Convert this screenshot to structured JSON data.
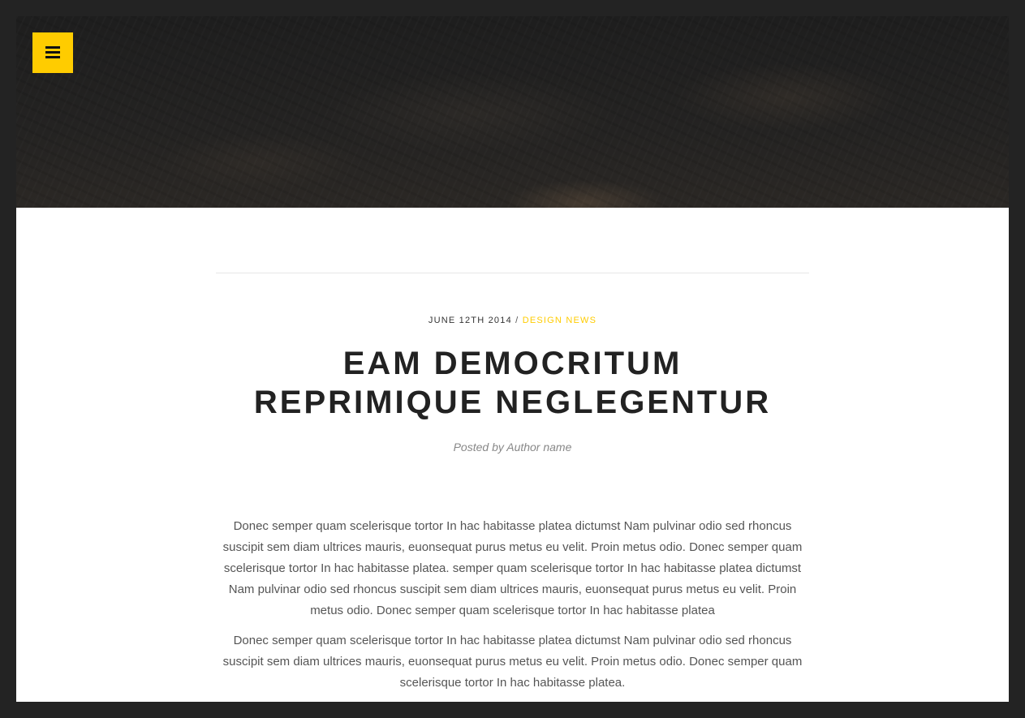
{
  "header": {
    "menu_icon": "hamburger-menu-icon",
    "accent_color": "#ffcc00"
  },
  "post": {
    "date": "JUNE 12TH 2014",
    "separator": "/",
    "category": "DESIGN NEWS",
    "title_line1": "EAM DEMOCRITUM",
    "title_line2": "REPRIMIQUE NEGLEGENTUR",
    "byline": "Posted by Author name",
    "paragraphs": [
      "Donec semper quam scelerisque tortor In hac habitasse platea dictumst Nam pulvinar odio sed rhoncus suscipit sem diam ultrices mauris, euonsequat purus metus eu velit. Proin metus odio. Donec semper quam scelerisque tortor In hac habitasse platea. semper quam scelerisque tortor In hac habitasse platea dictumst Nam pulvinar odio sed rhoncus suscipit sem diam ultrices mauris, euonsequat purus metus eu velit. Proin metus odio. Donec semper quam scelerisque tortor In hac habitasse platea",
      "Donec semper quam scelerisque tortor In hac habitasse platea dictumst Nam pulvinar odio sed rhoncus suscipit sem diam ultrices mauris, euonsequat purus metus eu velit. Proin metus odio. Donec semper quam scelerisque tortor In hac habitasse platea."
    ]
  }
}
